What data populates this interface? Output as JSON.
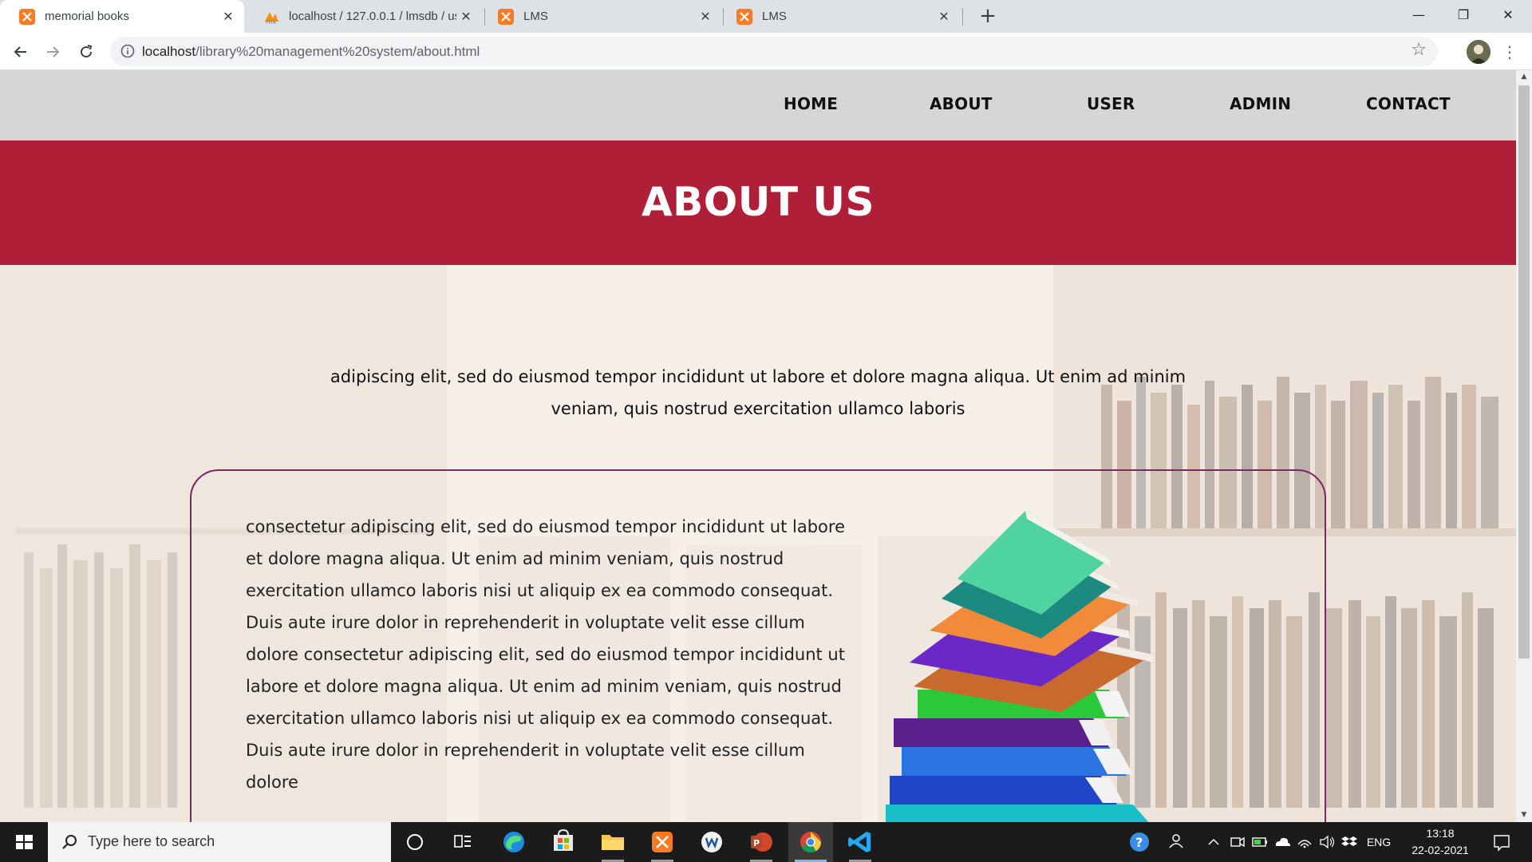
{
  "browser": {
    "tabs": [
      {
        "title": "memorial books",
        "active": true
      },
      {
        "title": "localhost / 127.0.0.1 / lmsdb / us",
        "active": false
      },
      {
        "title": "LMS",
        "active": false
      },
      {
        "title": "LMS",
        "active": false
      }
    ],
    "url_host": "localhost",
    "url_path": "/library%20management%20system/about.html"
  },
  "nav": {
    "items": [
      "HOME",
      "ABOUT",
      "USER",
      "ADMIN",
      "CONTACT"
    ]
  },
  "hero": {
    "title": "ABOUT US"
  },
  "intro": "adipiscing elit, sed do eiusmod tempor incididunt ut labore et dolore magna aliqua. Ut enim ad minim veniam, quis nostrud exercitation ullamco laboris",
  "box": {
    "text": "consectetur adipiscing elit, sed do eiusmod tempor incididunt ut labore et dolore magna aliqua. Ut enim ad minim veniam, quis nostrud exercitation ullamco laboris nisi ut aliquip ex ea commodo consequat. Duis aute irure dolor in reprehenderit in voluptate velit esse cillum dolore consectetur adipiscing elit, sed do eiusmod tempor incididunt ut labore et dolore magna aliqua. Ut enim ad minim veniam, quis nostrud exercitation ullamco laboris nisi ut aliquip ex ea commodo consequat. Duis aute irure dolor in reprehenderit in voluptate velit esse cillum dolore"
  },
  "taskbar": {
    "search_placeholder": "Type here to search",
    "language": "ENG",
    "time": "13:18",
    "date": "22-02-2021"
  },
  "colors": {
    "hero_bg": "#b01f38",
    "nav_bg": "#d6d6d6",
    "box_border": "#7a2a63"
  }
}
